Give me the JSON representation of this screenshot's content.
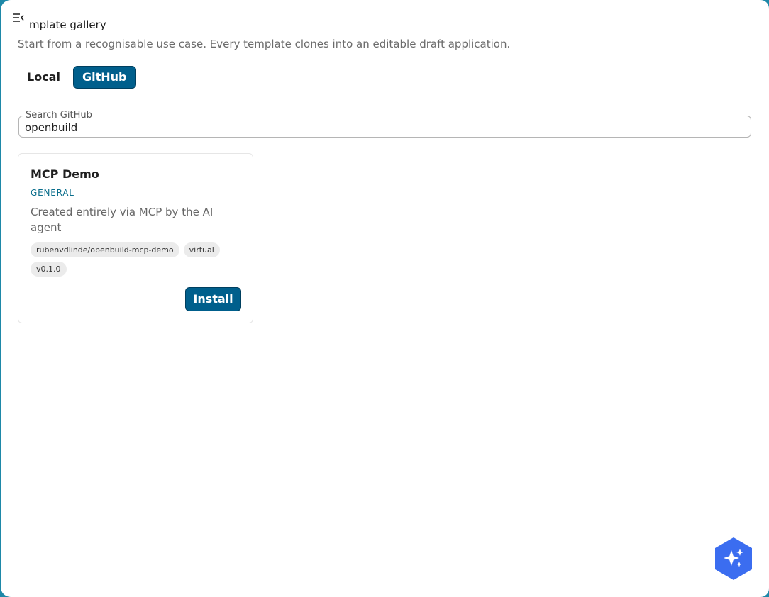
{
  "header": {
    "menu_icon": "menu-collapse-icon",
    "title": "mplate gallery",
    "subtitle": "Start from a recognisable use case. Every template clones into an editable draft application."
  },
  "tabs": [
    {
      "label": "Local",
      "active": false
    },
    {
      "label": "GitHub",
      "active": true
    }
  ],
  "search": {
    "label": "Search GitHub",
    "value": "openbuild"
  },
  "cards": [
    {
      "title": "MCP Demo",
      "category": "GENERAL",
      "description": "Created entirely via MCP by the AI agent",
      "tags": [
        "rubenvdlinde/openbuild-mcp-demo",
        "virtual",
        "v0.1.0"
      ],
      "install_label": "Install"
    }
  ],
  "fab": {
    "icon": "sparkles-icon"
  },
  "colors": {
    "accent": "#005f8c",
    "accent_border": "#003f5f",
    "category_text": "#0a6e8c",
    "fab": "#3b6df0",
    "frame": "#1e88a8"
  }
}
